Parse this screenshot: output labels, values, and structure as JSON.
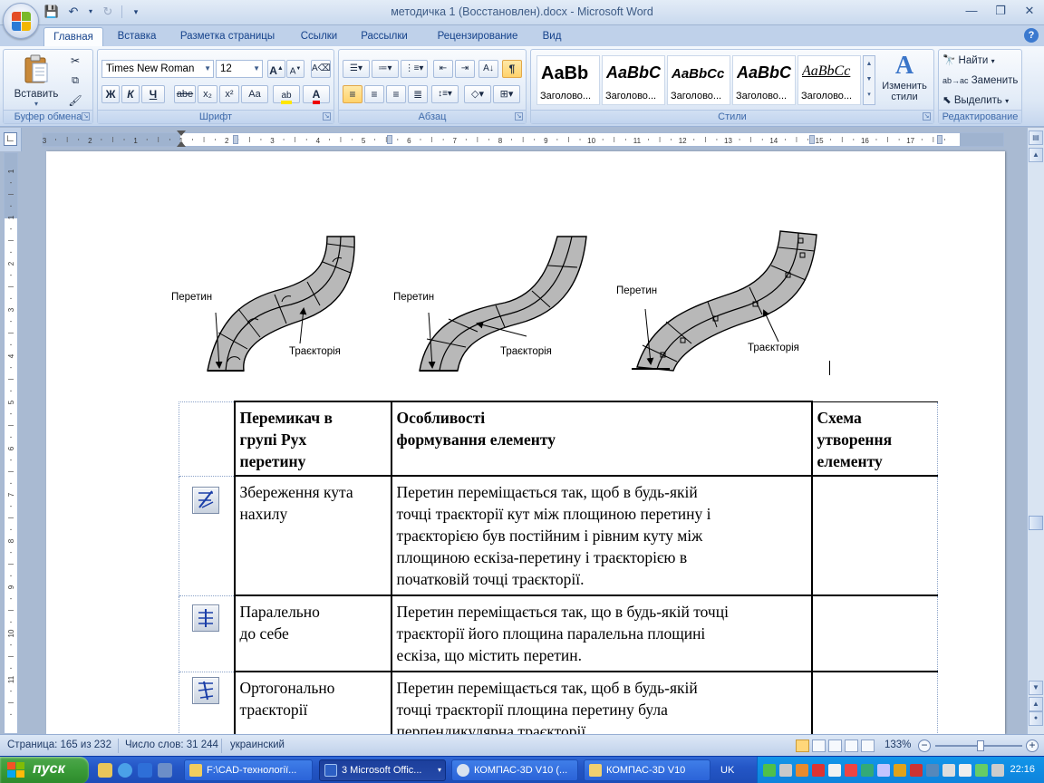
{
  "window": {
    "title": "методичка 1  (Восстановлен).docx - Microsoft Word",
    "controls": {
      "minimize": "—",
      "restore": "❐",
      "close": "✕"
    }
  },
  "ribbon_tabs": [
    "Главная",
    "Вставка",
    "Разметка страницы",
    "Ссылки",
    "Рассылки",
    "Рецензирование",
    "Вид"
  ],
  "clipboard": {
    "paste_label": "Вставить",
    "group_label": "Буфер обмена"
  },
  "font": {
    "name": "Times New Roman",
    "size": "12",
    "group_label": "Шрифт",
    "bold": "Ж",
    "italic": "К",
    "underline": "Ч",
    "strike": "abe",
    "subscript": "x₂",
    "superscript": "x²",
    "case": "Aa"
  },
  "paragraph": {
    "group_label": "Абзац"
  },
  "styles": {
    "group_label": "Стили",
    "items": [
      {
        "sample": "AaBb",
        "name": "Заголово..."
      },
      {
        "sample": "AaBbC",
        "name": "Заголово..."
      },
      {
        "sample": "AaBbCc",
        "name": "Заголово..."
      },
      {
        "sample": "AaBbC",
        "name": "Заголово..."
      },
      {
        "sample": "AaBbCc",
        "name": "Заголово..."
      }
    ],
    "change_label_1": "Изменить",
    "change_label_2": "стили"
  },
  "editing": {
    "group_label": "Редактирование",
    "find": "Найти",
    "replace": "Заменить",
    "select": "Выделить"
  },
  "figure": {
    "labels": [
      {
        "section": "Перетин",
        "trajectory": "Траєкторія"
      },
      {
        "section": "Перетин",
        "trajectory": "Траєкторія"
      },
      {
        "section": "Перетин",
        "trajectory": "Траєкторія"
      }
    ]
  },
  "table": {
    "header": {
      "col1_line1": "Перемикач в",
      "col1_line2": "групі Рух",
      "col1_line3": "перетину",
      "col2_line1": "Особливості",
      "col2_line2": "формування елементу",
      "col3_line1": "Схема",
      "col3_line2": "утворення",
      "col3_line3": "елементу"
    },
    "rows": [
      {
        "name_line1": "Збереження  кута",
        "name_line2": "нахилу",
        "desc_line1": "Перетин переміщається  так, щоб в будь-якій",
        "desc_line2": "точці траєкторії кут між площиною перетину і",
        "desc_line3": "траєкторією був постійним і рівним куту між",
        "desc_line4": "площиною ескіза-перетину  і траєкторією в",
        "desc_line5": "початковій точці траєкторії."
      },
      {
        "name_line1": "Паралельно",
        "name_line2": "до себе",
        "desc_line1": "Перетин переміщається  так, що в будь-якій точці",
        "desc_line2": "траєкторії його площина паралельна площині",
        "desc_line3": "ескіза, що містить перетин."
      },
      {
        "name_line1": "Ортогонально",
        "name_line2": "траєкторії",
        "desc_line1": "Перетин переміщається  так, щоб в будь-якій",
        "desc_line2": "точці траєкторії площина перетину була",
        "desc_line3": "перпендикулярна траєкторії."
      }
    ]
  },
  "status": {
    "page": "Страница: 165 из 232",
    "words": "Число слов: 31 244",
    "language": "украинский",
    "zoom": "133%",
    "zoom_fraction": 0.5
  },
  "taskbar": {
    "start": "пуск",
    "tasks": [
      "F:\\CAD-технології...",
      "3 Microsoft Offic...",
      "КОМПАС-3D V10 (...",
      "КОМПАС-3D V10"
    ],
    "lang": "UK",
    "clock": "22:16"
  },
  "ruler": {
    "h_numbers": [
      "3",
      "2",
      "1",
      "1",
      "2",
      "3",
      "4",
      "5",
      "6",
      "7",
      "8",
      "9",
      "10",
      "11",
      "12",
      "13",
      "14",
      "15",
      "16",
      "17"
    ],
    "v_numbers": [
      "1",
      "1",
      "2",
      "3",
      "4",
      "5",
      "6",
      "7",
      "8",
      "9",
      "10",
      "11"
    ]
  }
}
